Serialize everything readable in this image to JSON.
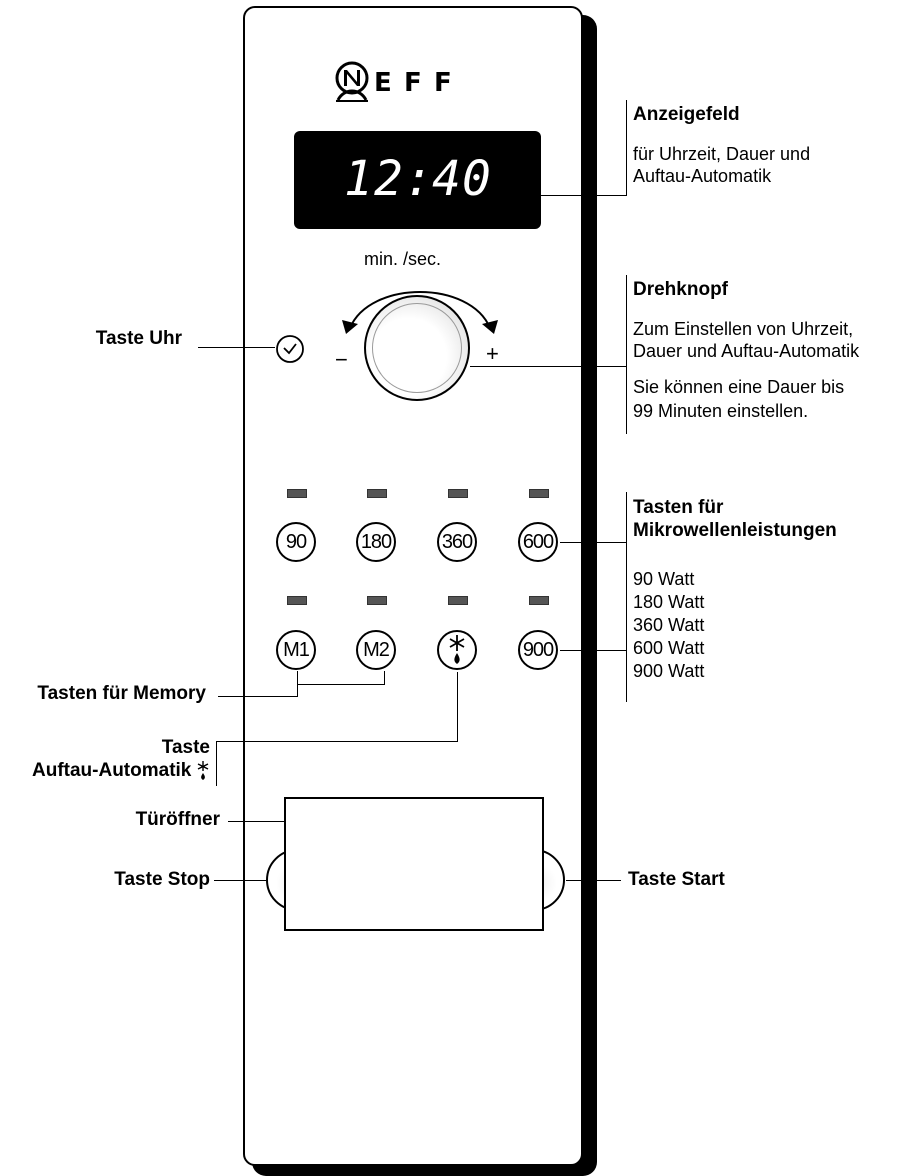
{
  "brand": {
    "logo_text": "NEFF",
    "letters": [
      "E",
      "F",
      "F"
    ]
  },
  "display": {
    "time": "12:40",
    "digits": [
      "1",
      "2",
      ":",
      "4",
      "0"
    ]
  },
  "knob": {
    "scale_label": "min. /sec.",
    "minus": "−",
    "plus": "+"
  },
  "power_buttons": {
    "row1": [
      "90",
      "180",
      "360",
      "600"
    ],
    "row2": [
      "M1",
      "M2",
      "900"
    ]
  },
  "defrost_button_icon": "snowflake-drop-icon",
  "bottom_buttons": {
    "stop": "stop",
    "start": "start"
  },
  "callouts": {
    "anzeigefeld": {
      "title": "Anzeigefeld",
      "desc_lines": [
        "für Uhrzeit, Dauer und",
        "Auftau-Automatik"
      ]
    },
    "drehknopf": {
      "title": "Drehknopf",
      "desc1_lines": [
        "Zum Einstellen von Uhrzeit,",
        "Dauer und Auftau-Automatik"
      ],
      "desc2_lines": [
        "Sie können eine Dauer bis",
        "99 Minuten einstellen."
      ]
    },
    "tasten_leistung": {
      "title_lines": [
        "Tasten für",
        "Mikrowellenleistungen"
      ],
      "watt_lines": [
        "90 Watt",
        "180 Watt",
        "360 Watt",
        "600 Watt",
        "900 Watt"
      ]
    },
    "taste_uhr": "Taste Uhr",
    "tasten_memory": "Tasten für Memory",
    "taste_auftau_lines": [
      "Taste",
      "Auftau-Automatik"
    ],
    "taste_stop": "Taste Stop",
    "taste_start": "Taste Start",
    "tueroeffner": "Türöffner"
  }
}
